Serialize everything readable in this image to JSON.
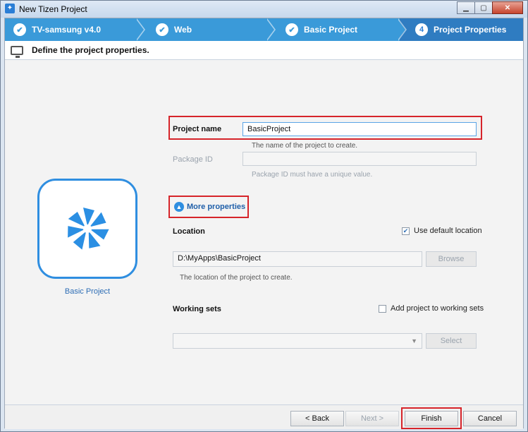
{
  "window": {
    "title": "New Tizen Project"
  },
  "steps": [
    {
      "label": "TV-samsung  v4.0",
      "state": "done",
      "icon": "check-icon"
    },
    {
      "label": "Web",
      "state": "done",
      "icon": "check-icon"
    },
    {
      "label": "Basic Project",
      "state": "done",
      "icon": "check-icon"
    },
    {
      "label": "Project Properties",
      "state": "active",
      "number": "4"
    }
  ],
  "header": {
    "title": "Define the project properties."
  },
  "template": {
    "name": "Basic Project",
    "icon": "tizen-pinwheel-icon"
  },
  "form": {
    "project_name_label": "Project name",
    "project_name_value": "BasicProject",
    "project_name_hint": "The name of the project to create.",
    "package_id_label": "Package ID",
    "package_id_value": "",
    "package_id_hint": "Package ID must have a unique value.",
    "more_properties_label": "More properties",
    "location_label": "Location",
    "use_default_location_label": "Use default location",
    "use_default_location_checked": true,
    "location_value": "D:\\MyApps\\BasicProject",
    "browse_label": "Browse",
    "location_hint": "The location of the project to create.",
    "working_sets_label": "Working sets",
    "add_to_working_sets_label": "Add project to working sets",
    "add_to_working_sets_checked": false,
    "working_sets_value": "",
    "select_label": "Select"
  },
  "footer": {
    "back_label": "< Back",
    "next_label": "Next >",
    "finish_label": "Finish",
    "cancel_label": "Cancel"
  },
  "colors": {
    "accent": "#3a9ad9",
    "highlight_border": "#d6242a",
    "link": "#1f5fa9"
  }
}
